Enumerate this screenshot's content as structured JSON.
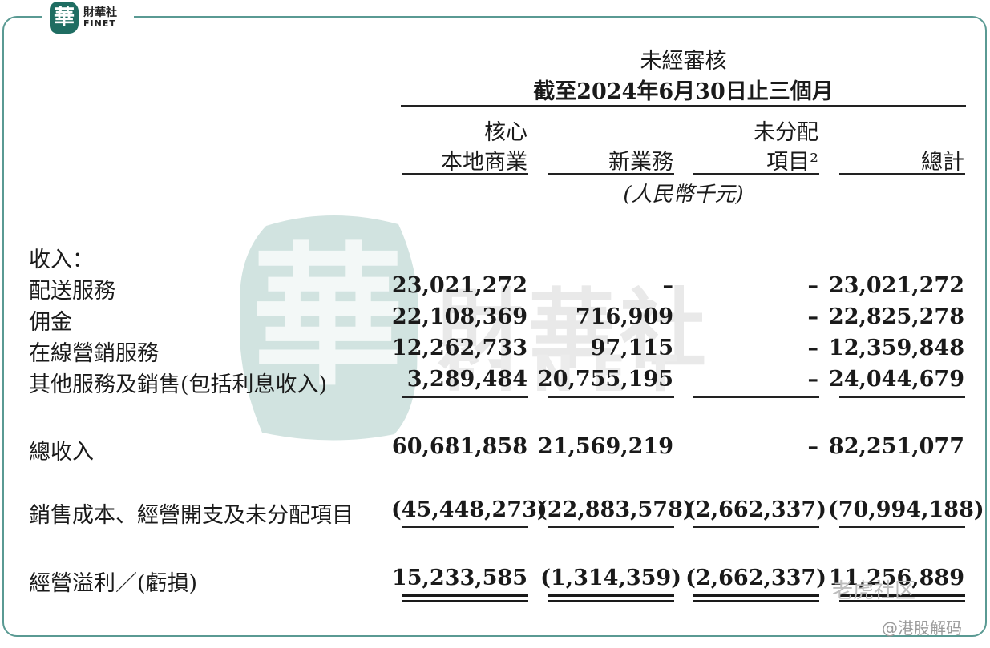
{
  "logo": {
    "seal_char": "華",
    "name_cn": "財華社",
    "name_en": "FINET"
  },
  "watermark": {
    "seal_char": "華",
    "name_cn": "財華社",
    "name_en": "FINET"
  },
  "header": {
    "status": "未經審核",
    "period": "截至2024年6月30日止三個月",
    "columns": [
      {
        "line1": "核心",
        "line2": "本地商業"
      },
      {
        "line1": "",
        "line2": "新業務"
      },
      {
        "line1": "未分配",
        "line2": "項目²"
      },
      {
        "line1": "",
        "line2": "總計"
      }
    ],
    "unit": "(人民幣千元)"
  },
  "rows": [
    {
      "label": "收入：",
      "values": [
        "",
        "",
        "",
        ""
      ]
    },
    {
      "label": "配送服務",
      "values": [
        "23,021,272",
        "–",
        "–",
        "23,021,272"
      ]
    },
    {
      "label": "佣金",
      "values": [
        "22,108,369",
        "716,909",
        "–",
        "22,825,278"
      ]
    },
    {
      "label": "在線營銷服務",
      "values": [
        "12,262,733",
        "97,115",
        "–",
        "12,359,848"
      ]
    },
    {
      "label": "其他服務及銷售(包括利息收入)",
      "values": [
        "3,289,484",
        "20,755,195",
        "–",
        "24,044,679"
      ]
    },
    {
      "label": "總收入",
      "values": [
        "60,681,858",
        "21,569,219",
        "–",
        "82,251,077"
      ]
    },
    {
      "label": "銷售成本、經營開支及未分配項目",
      "values": [
        "(45,448,273)",
        "(22,883,578)",
        "(2,662,337)",
        "(70,994,188)"
      ]
    },
    {
      "label": "經營溢利／(虧損)",
      "values": [
        "15,233,585",
        "(1,314,359)",
        "(2,662,337)",
        "11,256,889"
      ]
    }
  ],
  "overlay": {
    "tiger_watermark": "老虎社区",
    "credit": "@港股解码"
  },
  "colors": {
    "frame": "#5a9a93",
    "seal": "#1f6d62",
    "watermark": "#6fa9a0"
  }
}
